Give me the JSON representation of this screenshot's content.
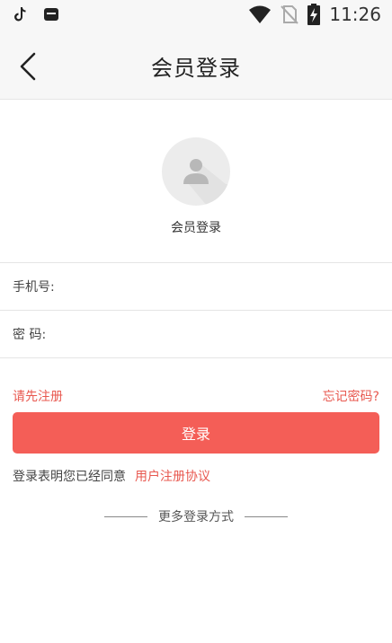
{
  "status_bar": {
    "time": "11:26"
  },
  "nav": {
    "title": "会员登录"
  },
  "profile": {
    "label": "会员登录"
  },
  "form": {
    "phone_label": "手机号:",
    "phone_value": "",
    "password_label": "密 码:",
    "password_value": ""
  },
  "links": {
    "register": "请先注册",
    "forgot": "忘记密码?"
  },
  "login_button": "登录",
  "agreement": {
    "text": "登录表明您已经同意",
    "link": "用户注册协议"
  },
  "more_login": "更多登录方式",
  "colors": {
    "accent": "#f45e57",
    "link": "#e8584f",
    "header_bg": "#f7f7f7"
  }
}
